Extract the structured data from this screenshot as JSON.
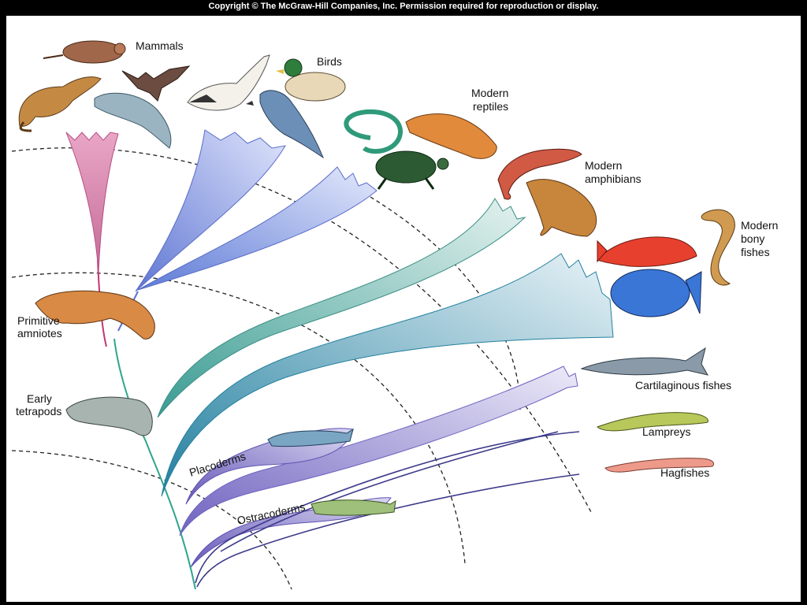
{
  "copyright": "Copyright © The McGraw-Hill Companies, Inc. Permission required for reproduction or display.",
  "labels": {
    "mammals": "Mammals",
    "birds": "Birds",
    "modern_reptiles": [
      "Modern",
      "reptiles"
    ],
    "modern_amphibians": [
      "Modern",
      "amphibians"
    ],
    "modern_bony_fishes": [
      "Modern",
      "bony",
      "fishes"
    ],
    "cartilaginous_fishes": "Cartilaginous fishes",
    "lampreys": "Lampreys",
    "hagfishes": "Hagfishes",
    "placoderms": "Placoderms",
    "ostracoderms": "Ostracoderms",
    "primitive_amniotes": [
      "Primitive",
      "amniotes"
    ],
    "early_tetrapods": [
      "Early",
      "tetrapods"
    ]
  },
  "colors": {
    "mammal_lineage": "#e9a6c6",
    "bird_lineage": "#8f9fe2",
    "reptile_lineage": "#7d98de",
    "amphibian_lineage": "#4fa79c",
    "bony_fish_lineage": "#2f8fae",
    "cartilaginous_lineage": "#8a7fd0",
    "agnathan_lines": "#3c3a8a",
    "trunk": "#2fa58d"
  }
}
